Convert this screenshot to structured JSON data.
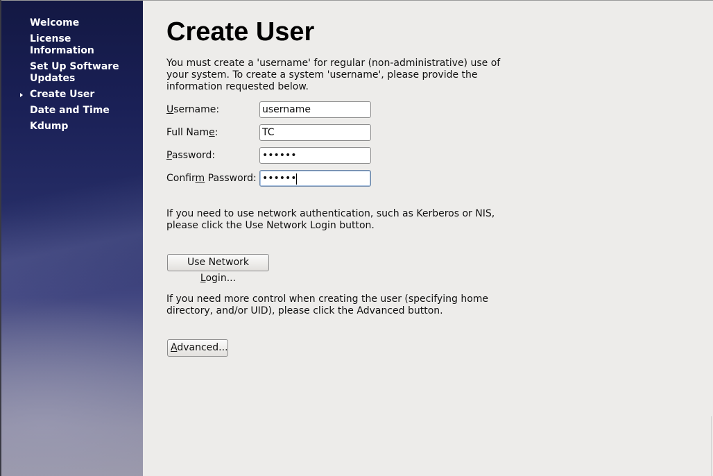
{
  "sidebar": {
    "items": [
      {
        "label": "Welcome"
      },
      {
        "label": "License Information"
      },
      {
        "label": "Set Up Software Updates"
      },
      {
        "label": "Create User",
        "current": true
      },
      {
        "label": "Date and Time"
      },
      {
        "label": "Kdump"
      }
    ]
  },
  "main": {
    "title": "Create User",
    "intro": "You must create a 'username' for regular (non-administrative) use of your system.  To create a system 'username', please provide the information requested below.",
    "form": {
      "username": {
        "label_pre": "",
        "label_mnemonic": "U",
        "label_post": "sername:",
        "value": "username"
      },
      "fullname": {
        "label_pre": "Full Nam",
        "label_mnemonic": "e",
        "label_post": ":",
        "value": "TC"
      },
      "password": {
        "label_pre": "",
        "label_mnemonic": "P",
        "label_post": "assword:",
        "value": "••••••"
      },
      "confirm": {
        "label_pre": "Confir",
        "label_mnemonic": "m",
        "label_post": " Password:",
        "value": "••••••"
      }
    },
    "network_text": "If you need to use network authentication, such as Kerberos or NIS, please click the Use Network Login button.",
    "network_button": {
      "pre": "Use Network ",
      "mnemonic": "L",
      "post": "ogin..."
    },
    "advanced_text": "If you need more control when creating the user (specifying home directory, and/or UID), please click the Advanced button.",
    "advanced_button": {
      "pre": "",
      "mnemonic": "A",
      "post": "dvanced..."
    }
  },
  "colors": {
    "sidebar_top": "#131843",
    "sidebar_bottom": "#9a98a8",
    "content_bg": "#edecea",
    "focus_border": "#6d87a8"
  }
}
